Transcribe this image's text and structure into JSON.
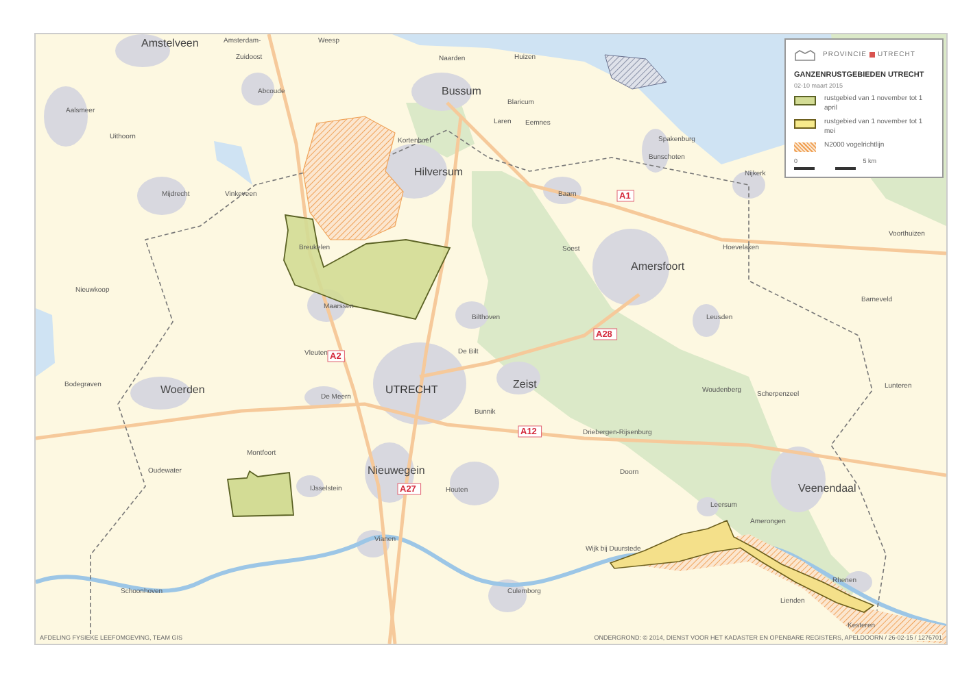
{
  "legend": {
    "logo": [
      "PROVINCIE",
      "UTRECHT"
    ],
    "title": "GANZENRUSTGEBIEDEN UTRECHT",
    "date": "02-10 maart 2015",
    "items": [
      {
        "kind": "olive",
        "label": "rustgebied van 1 november tot 1 april"
      },
      {
        "kind": "yellow",
        "label": "rustgebied van 1 november tot 1 mei"
      },
      {
        "kind": "hatch",
        "label": "N2000 vogelrichtlijn"
      }
    ],
    "scale": {
      "start": "0",
      "end": "5 km"
    }
  },
  "map": {
    "labels": [
      {
        "text": "Amstelveen",
        "kind": "large"
      },
      {
        "text": "Amsterdam-",
        "kind": "small"
      },
      {
        "text": "Weesp",
        "kind": "small"
      },
      {
        "text": "Zuidoost",
        "kind": "small"
      },
      {
        "text": "Naarden",
        "kind": "small"
      },
      {
        "text": "Huizen",
        "kind": "small"
      },
      {
        "text": "Abcoude",
        "kind": "small"
      },
      {
        "text": "Bussum",
        "kind": "large"
      },
      {
        "text": "Aalsmeer",
        "kind": "small"
      },
      {
        "text": "Blaricum",
        "kind": "small"
      },
      {
        "text": "Laren",
        "kind": "small"
      },
      {
        "text": "Eemnes",
        "kind": "small"
      },
      {
        "text": "Uithoorn",
        "kind": "small"
      },
      {
        "text": "Kortenhoef",
        "kind": "small"
      },
      {
        "text": "Spakenburg",
        "kind": "small"
      },
      {
        "text": "Bunschoten",
        "kind": "small"
      },
      {
        "text": "Hilversum",
        "kind": "large"
      },
      {
        "text": "Nijkerk",
        "kind": "small"
      },
      {
        "text": "Mijdrecht",
        "kind": "small"
      },
      {
        "text": "Vinkeveen",
        "kind": "small"
      },
      {
        "text": "Baarn",
        "kind": "small"
      },
      {
        "text": "A1",
        "kind": "road"
      },
      {
        "text": "Voorthuizen",
        "kind": "small"
      },
      {
        "text": "Breukelen",
        "kind": "small"
      },
      {
        "text": "Soest",
        "kind": "small"
      },
      {
        "text": "Hoevelaken",
        "kind": "small"
      },
      {
        "text": "Amersfoort",
        "kind": "large"
      },
      {
        "text": "Nieuwkoop",
        "kind": "small"
      },
      {
        "text": "Barneveld",
        "kind": "small"
      },
      {
        "text": "Maarssen",
        "kind": "small"
      },
      {
        "text": "Bilthoven",
        "kind": "small"
      },
      {
        "text": "Leusden",
        "kind": "small"
      },
      {
        "text": "A28",
        "kind": "road"
      },
      {
        "text": "Vleuten",
        "kind": "small"
      },
      {
        "text": "A2",
        "kind": "road"
      },
      {
        "text": "De Bilt",
        "kind": "small"
      },
      {
        "text": "Bodegraven",
        "kind": "small"
      },
      {
        "text": "Woerden",
        "kind": "large"
      },
      {
        "text": "De Meern",
        "kind": "small"
      },
      {
        "text": "UTRECHT",
        "kind": "capital"
      },
      {
        "text": "Zeist",
        "kind": "large"
      },
      {
        "text": "Woudenberg",
        "kind": "small"
      },
      {
        "text": "Scherpenzeel",
        "kind": "small"
      },
      {
        "text": "Lunteren",
        "kind": "small"
      },
      {
        "text": "Bunnik",
        "kind": "small"
      },
      {
        "text": "A12",
        "kind": "road"
      },
      {
        "text": "Driebergen-Rijsenburg",
        "kind": "small"
      },
      {
        "text": "Montfoort",
        "kind": "small"
      },
      {
        "text": "Oudewater",
        "kind": "small"
      },
      {
        "text": "Nieuwegein",
        "kind": "large"
      },
      {
        "text": "Doorn",
        "kind": "small"
      },
      {
        "text": "IJsselstein",
        "kind": "small"
      },
      {
        "text": "A27",
        "kind": "road"
      },
      {
        "text": "Houten",
        "kind": "small"
      },
      {
        "text": "Veenendaal",
        "kind": "large"
      },
      {
        "text": "Leersum",
        "kind": "small"
      },
      {
        "text": "Amerongen",
        "kind": "small"
      },
      {
        "text": "Vianen",
        "kind": "small"
      },
      {
        "text": "Wijk bij Duurstede",
        "kind": "small"
      },
      {
        "text": "Rhenen",
        "kind": "small"
      },
      {
        "text": "Schoonhoven",
        "kind": "small"
      },
      {
        "text": "Culemborg",
        "kind": "small"
      },
      {
        "text": "Lienden",
        "kind": "small"
      },
      {
        "text": "Kesteren",
        "kind": "small"
      }
    ]
  },
  "footer": {
    "left": "AFDELING FYSIEKE LEEFOMGEVING, TEAM GIS",
    "right": "ONDERGROND: © 2014, DIENST VOOR HET KADASTER EN OPENBARE REGISTERS, APELDOORN / 26-02-15 / 1276701"
  }
}
